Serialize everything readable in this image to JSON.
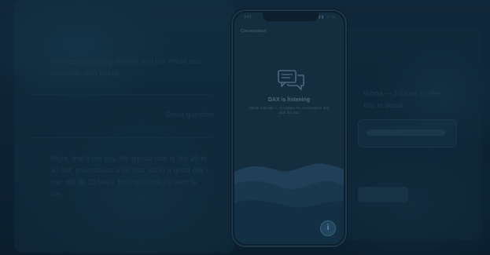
{
  "background": {
    "left_text_1": "I've been tweaking alerting and the whole test coverage plan today.",
    "left_text_2": "Great question",
    "left_text_3": "Right, that's the key. My typical rate is like 20 to 30 out, yours takes a lot less. All in a good day I can still do 20 trials, but right now it's hard to say.",
    "right_text": "Whoa — I'd love to see this in detail"
  },
  "phone": {
    "status_time": "9:41",
    "status_icons": "▮▮▮ ◔ ▭",
    "header": "Conversation",
    "title": "DAX is listening",
    "subtitle": "Speak naturally — I'll capture the conversation and draft the note",
    "fab_icon": "info-icon",
    "fab_glyph": "i"
  },
  "colors": {
    "backdrop": "#0d2434",
    "screen": "#1b3a4e",
    "wave_light": "#2c5670",
    "wave_mid": "#224a63",
    "wave_dark": "#193d54"
  }
}
